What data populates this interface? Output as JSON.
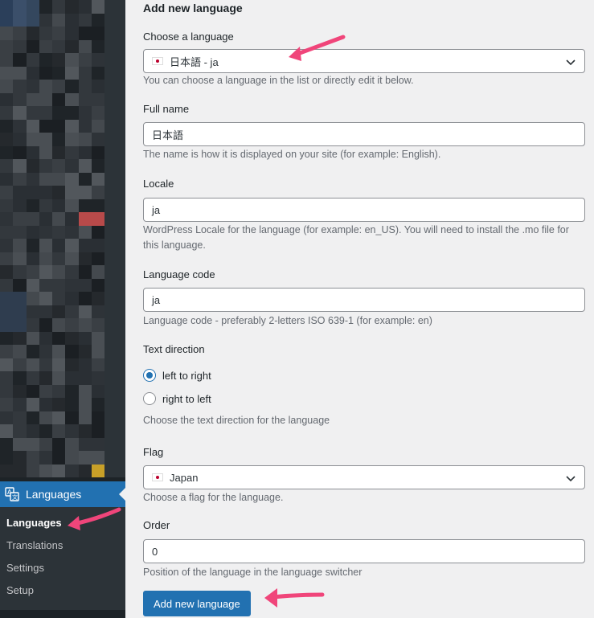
{
  "sidebar": {
    "menu_label": "Languages",
    "menu_icon": "translation-icon",
    "items": [
      {
        "label": "Languages",
        "current": true
      },
      {
        "label": "Translations"
      },
      {
        "label": "Settings"
      },
      {
        "label": "Setup"
      }
    ]
  },
  "form": {
    "title": "Add new language",
    "choose_language": {
      "label": "Choose a language",
      "value": "日本語 - ja",
      "help": "You can choose a language in the list or directly edit it below."
    },
    "full_name": {
      "label": "Full name",
      "value": "日本語",
      "help": "The name is how it is displayed on your site (for example: English)."
    },
    "locale": {
      "label": "Locale",
      "value": "ja",
      "help": "WordPress Locale for the language (for example: en_US). You will need to install the .mo file for this language."
    },
    "language_code": {
      "label": "Language code",
      "value": "ja",
      "help": "Language code - preferably 2-letters ISO 639-1 (for example: en)"
    },
    "text_direction": {
      "label": "Text direction",
      "options": [
        {
          "label": "left to right",
          "checked": true
        },
        {
          "label": "right to left",
          "checked": false
        }
      ],
      "help": "Choose the text direction for the language"
    },
    "flag": {
      "label": "Flag",
      "value": "Japan",
      "help": "Choose a flag for the language."
    },
    "order": {
      "label": "Order",
      "value": "0",
      "help": "Position of the language in the language switcher"
    },
    "submit_label": "Add new language"
  },
  "colors": {
    "accent": "#2271b1",
    "sidebar_bg": "#1d2327",
    "annotation_arrow": "#f0457a"
  }
}
